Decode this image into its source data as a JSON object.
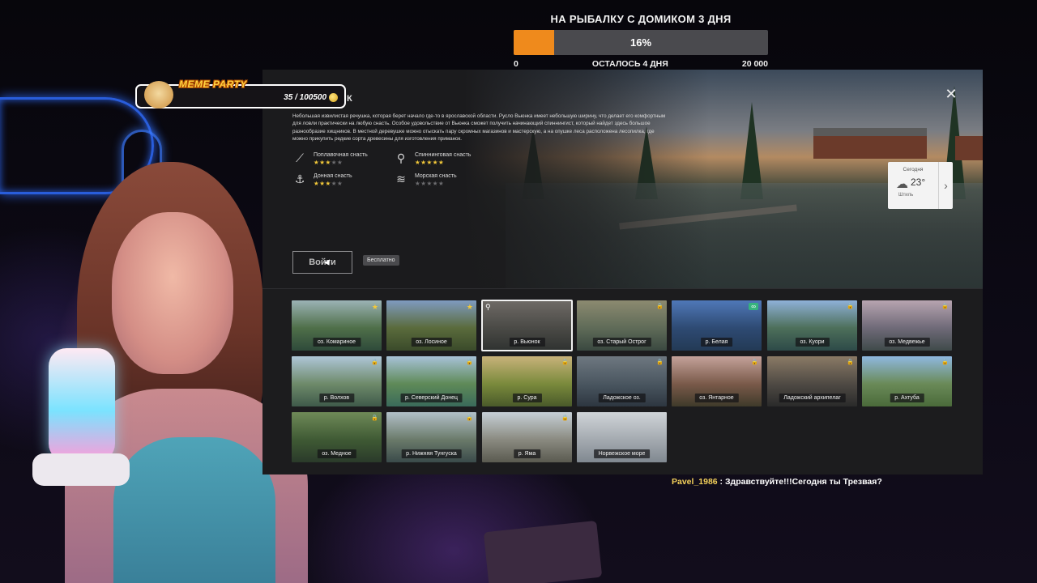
{
  "event": {
    "title": "НА РЫБАЛКУ С ДОМИКОМ 3 ДНЯ",
    "progress_label": "16%",
    "progress_fraction": 0.16,
    "min_label": "0",
    "remaining_label": "ОСТАЛОСЬ 4 ДНЯ",
    "max_label": "20 000"
  },
  "meme": {
    "title": "MEME PARTY",
    "count": "35 / 100500",
    "partial_heading": "К"
  },
  "location": {
    "description": "Небольшая извилистая речушка, которая берет начало где-то в ярославской области. Русло Вьюнка имеет небольшую ширину, что делает его комфортным для ловли практически на любую снасть. Особое удовольствие от Вьюнка сможет получить начинающий спиннингист, который найдет здесь большое разнообразие хищников. В местной деревушке можно отыскать пару скромных магазинов и мастерскую, а на опушке леса расположена лесопилка, где можно прикупить редкие сорта древесины для изготовления приманок.",
    "tackle": [
      {
        "name": "Поплавочная снасть",
        "rating": 2.5,
        "icon": "float-rod-icon",
        "glyph": "⟋"
      },
      {
        "name": "Спиннинговая снасть",
        "rating": 5,
        "icon": "spinning-rod-icon",
        "glyph": "⚲"
      },
      {
        "name": "Донная снасть",
        "rating": 2.5,
        "icon": "bottom-rod-icon",
        "glyph": "⚓"
      },
      {
        "name": "Морская снасть",
        "rating": 0,
        "icon": "sea-rod-icon",
        "glyph": "≋"
      }
    ],
    "enter_label": "Войти",
    "free_label": "Бесплатно",
    "close_glyph": "✕",
    "weather": {
      "label": "Сегодня",
      "temperature": "23°",
      "condition": "Штиль",
      "cloud_glyph": "☁",
      "arrow_glyph": "›"
    }
  },
  "tiles": [
    {
      "label": "оз. Комариное",
      "badge": "star",
      "colors": [
        "#9bb3b5",
        "#4f6f49",
        "#2e4a3a"
      ]
    },
    {
      "label": "оз. Лосиное",
      "badge": "star",
      "colors": [
        "#7f9bc0",
        "#5a6b3c",
        "#3a4a2a"
      ]
    },
    {
      "label": "р. Вьюнок",
      "badge": "pin",
      "colors": [
        "#6f6a66",
        "#4a4a46",
        "#2f3230"
      ],
      "active": true
    },
    {
      "label": "оз. Старый Острог",
      "badge": "lock",
      "colors": [
        "#8c8a70",
        "#5f6b58",
        "#3a4840"
      ]
    },
    {
      "label": "р. Белая",
      "badge": "infinity",
      "colors": [
        "#4f78b8",
        "#2e4a73",
        "#233a55"
      ]
    },
    {
      "label": "оз. Куори",
      "badge": "lock",
      "colors": [
        "#8fb1d8",
        "#4d6f5a",
        "#2d4a48"
      ]
    },
    {
      "label": "оз. Медвежье",
      "badge": "lock",
      "colors": [
        "#b7a4b0",
        "#6f6a78",
        "#3f4a4a"
      ]
    },
    {
      "label": "р. Волхов",
      "badge": "lock",
      "colors": [
        "#aec6d8",
        "#6e8a6a",
        "#3f5a4a"
      ]
    },
    {
      "label": "р. Северский Донец",
      "badge": "lock",
      "colors": [
        "#a7c2d8",
        "#5f8a58",
        "#3a6a5a"
      ]
    },
    {
      "label": "р. Сура",
      "badge": "lock",
      "colors": [
        "#c8b27a",
        "#7a8a3c",
        "#4a5a2a"
      ]
    },
    {
      "label": "Ладожское оз.",
      "badge": "lock",
      "colors": [
        "#6e7880",
        "#4a5660",
        "#2d3640"
      ]
    },
    {
      "label": "оз. Янтарное",
      "badge": "lock",
      "colors": [
        "#c4a29a",
        "#7a5a4a",
        "#3f3a2a"
      ]
    },
    {
      "label": "Ладожский архипелаг",
      "badge": "lock",
      "colors": [
        "#8a7a66",
        "#4f4a44",
        "#2a2a2a"
      ]
    },
    {
      "label": "р. Ахтуба",
      "badge": "lock",
      "colors": [
        "#8fb8e0",
        "#6a8a58",
        "#4a6a3a"
      ]
    },
    {
      "label": "оз. Медное",
      "badge": "lock",
      "colors": [
        "#6f8a58",
        "#3f5a34",
        "#2a3a2a"
      ]
    },
    {
      "label": "р. Нижняя Тунгуска",
      "badge": "lock",
      "colors": [
        "#b2c0c8",
        "#6a7a6a",
        "#3a4a4a"
      ]
    },
    {
      "label": "р. Яма",
      "badge": "lock",
      "colors": [
        "#c6cfd6",
        "#8a8a80",
        "#5a5a50"
      ]
    },
    {
      "label": "Норвежское море",
      "badge": "none",
      "colors": [
        "#d0d4d8",
        "#a4aab0",
        "#808890"
      ]
    }
  ],
  "chat": {
    "user": "Pavel_1986",
    "message": " : Здравствуйте!!!Сегодня ты Трезвая?"
  },
  "colors": {
    "progress_fill": "#ef8a1c",
    "star_on": "#f3c93a",
    "chat_user": "#f3d05a",
    "meme_title": "#ffd23f"
  }
}
